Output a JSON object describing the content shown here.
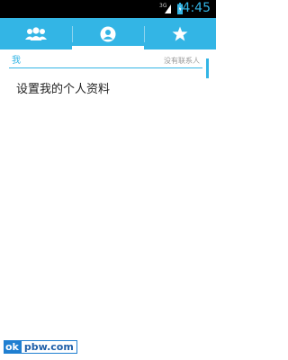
{
  "status_bar": {
    "network_label": "3G",
    "time": "4:45"
  },
  "tabs": [
    {
      "icon": "groups-icon"
    },
    {
      "icon": "person-icon",
      "selected": true
    },
    {
      "icon": "star-icon"
    }
  ],
  "section": {
    "title": "我",
    "status": "没有联系人"
  },
  "profile": {
    "setup_label": "设置我的个人资料"
  },
  "watermark": {
    "left": "ok",
    "right": "pbw.com"
  },
  "colors": {
    "accent": "#33b5e5",
    "status_bar": "#000000",
    "text": "#222222",
    "muted": "#999999"
  }
}
